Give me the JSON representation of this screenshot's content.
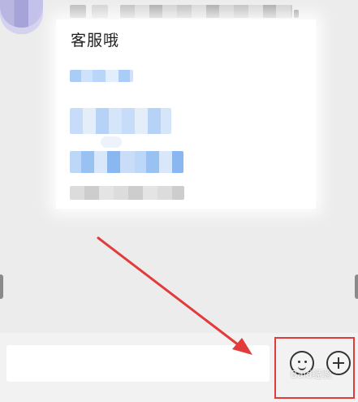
{
  "chat": {
    "message_title": "客服哦",
    "text_field_value": ""
  },
  "composer": {
    "emoji_icon": "smiley-face-icon",
    "add_icon": "plus-circle-icon"
  },
  "annotation": {
    "highlight_color": "#e23b3b",
    "arrow_color": "#e23b3b"
  },
  "watermark": {
    "text": "Baid经验"
  }
}
